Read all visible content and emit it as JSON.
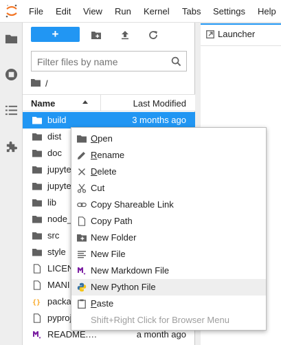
{
  "menubar": {
    "items": [
      "File",
      "Edit",
      "View",
      "Run",
      "Kernel",
      "Tabs",
      "Settings",
      "Help"
    ]
  },
  "activitybar": {
    "icons": [
      "folder-icon",
      "running-icon",
      "toc-icon",
      "extension-icon"
    ]
  },
  "filebrowser": {
    "new_launcher_label": "+",
    "filter_placeholder": "Filter files by name",
    "breadcrumb_path": "/",
    "header_name": "Name",
    "header_modified": "Last Modified",
    "files": [
      {
        "name": "build",
        "modified": "3 months ago",
        "icon": "folder-icon",
        "selected": true
      },
      {
        "name": "dist",
        "modified": "",
        "icon": "folder-icon"
      },
      {
        "name": "doc",
        "modified": "",
        "icon": "folder-icon"
      },
      {
        "name": "jupyte",
        "modified": "",
        "icon": "folder-icon"
      },
      {
        "name": "jupyte",
        "modified": "",
        "icon": "folder-icon"
      },
      {
        "name": "lib",
        "modified": "",
        "icon": "folder-icon"
      },
      {
        "name": "node_",
        "modified": "",
        "icon": "folder-icon"
      },
      {
        "name": "src",
        "modified": "",
        "icon": "folder-icon"
      },
      {
        "name": "style",
        "modified": "",
        "icon": "folder-icon"
      },
      {
        "name": "LICEN",
        "modified": "",
        "icon": "file-icon"
      },
      {
        "name": "MANI",
        "modified": "",
        "icon": "file-icon"
      },
      {
        "name": "packa",
        "modified": "",
        "icon": "json-icon"
      },
      {
        "name": "pyproj",
        "modified": "",
        "icon": "file-icon"
      },
      {
        "name": "README.…",
        "modified": "a month ago",
        "icon": "markdown-icon"
      }
    ]
  },
  "main": {
    "tab_label": "Launcher"
  },
  "context_menu": {
    "items": [
      {
        "label": "Open",
        "mnemonic": "O",
        "icon": "folder-icon"
      },
      {
        "label": "Rename",
        "mnemonic": "R",
        "icon": "edit-icon"
      },
      {
        "label": "Delete",
        "mnemonic": "D",
        "icon": "close-icon"
      },
      {
        "label": "Cut",
        "mnemonic": "",
        "icon": "cut-icon"
      },
      {
        "label": "Copy Shareable Link",
        "mnemonic": "",
        "icon": "link-icon"
      },
      {
        "label": "Copy Path",
        "mnemonic": "",
        "icon": "file-icon"
      },
      {
        "label": "New Folder",
        "mnemonic": "",
        "icon": "new-folder-icon"
      },
      {
        "label": "New File",
        "mnemonic": "",
        "icon": "text-file-icon"
      },
      {
        "label": "New Markdown File",
        "mnemonic": "",
        "icon": "markdown-icon"
      },
      {
        "label": "New Python File",
        "mnemonic": "",
        "icon": "python-icon",
        "hover": true
      },
      {
        "label": "Paste",
        "mnemonic": "P",
        "icon": "paste-icon"
      },
      {
        "label": "Shift+Right Click for Browser Menu",
        "mnemonic": "",
        "icon": "",
        "muted": true
      }
    ]
  },
  "colors": {
    "accent": "#2196f3",
    "brand_orange": "#f37626",
    "markdown_purple": "#7b1fa2",
    "json_orange": "#f9a825"
  }
}
